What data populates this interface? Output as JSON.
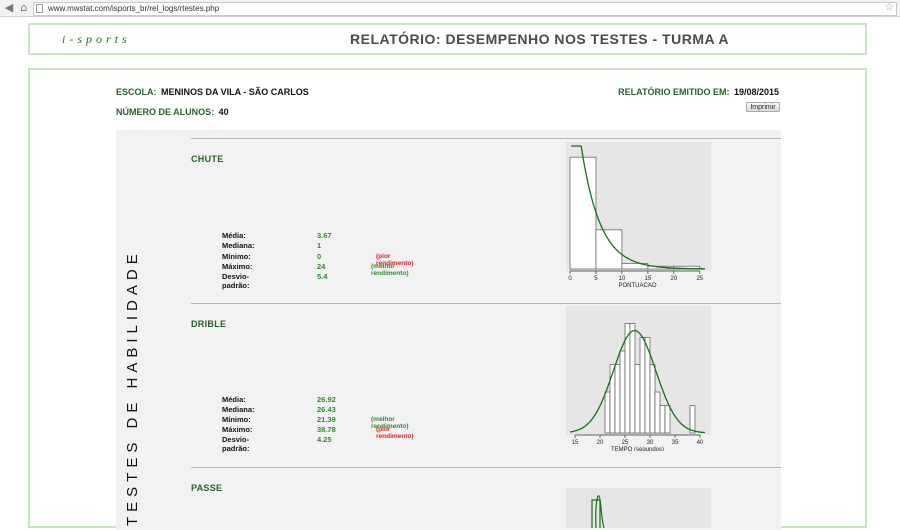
{
  "browser": {
    "url": "www.mwstat.com/isports_br/rel_logs/rtestes.php"
  },
  "header": {
    "logo": "i-sports",
    "title": "RELATÓRIO: DESEMPENHO NOS TESTES - TURMA A"
  },
  "info": {
    "school_label": "ESCOLA:",
    "school_value": "MENINOS DA VILA - SÃO CARLOS",
    "report_label": "RELATÓRIO EMITIDO EM:",
    "report_value": "19/08/2015",
    "students_label": "NÚMERO DE ALUNOS:",
    "students_value": "40",
    "print_label": "Imprimir"
  },
  "vertical_label": "TESTES DE HABILIDADE",
  "sections": [
    {
      "title": "CHUTE",
      "stats": [
        {
          "label": "Média:",
          "value": "3.67",
          "note": ""
        },
        {
          "label": "Mediana:",
          "value": "1",
          "note": ""
        },
        {
          "label": "Mínimo:",
          "value": "0",
          "note": "(pior rendimento)",
          "note_color": "red"
        },
        {
          "label": "Máximo:",
          "value": "24",
          "note": "(melhor rendimento)",
          "note_color": "green"
        },
        {
          "label": "Desvio-padrão:",
          "value": "5.4",
          "note": ""
        }
      ]
    },
    {
      "title": "DRIBLE",
      "stats": [
        {
          "label": "Média:",
          "value": "26.92",
          "note": ""
        },
        {
          "label": "Mediana:",
          "value": "26.43",
          "note": ""
        },
        {
          "label": "Mínimo:",
          "value": "21.39",
          "note": "(melhor rendimento)",
          "note_color": "green"
        },
        {
          "label": "Máximo:",
          "value": "38.78",
          "note": "(pior rendimento)",
          "note_color": "red"
        },
        {
          "label": "Desvio-padrão:",
          "value": "4.25",
          "note": ""
        }
      ]
    },
    {
      "title": "PASSE",
      "stats": []
    }
  ],
  "chart_data": [
    {
      "type": "bar",
      "xlabel": "PONTUACAO",
      "xlim": [
        0,
        26
      ],
      "ylim": [
        0,
        22
      ],
      "x_ticks": [
        0,
        5,
        10,
        15,
        20,
        25
      ],
      "bins": [
        {
          "x0": 0,
          "x1": 5,
          "count": 20
        },
        {
          "x0": 5,
          "x1": 10,
          "count": 7
        },
        {
          "x0": 10,
          "x1": 15,
          "count": 1
        },
        {
          "x0": 15,
          "x1": 20,
          "count": 0.5
        },
        {
          "x0": 20,
          "x1": 25,
          "count": 0.5
        }
      ],
      "curve": {
        "kind": "exponential",
        "mean": 3.67
      },
      "colors": {
        "bars": "#555555",
        "curve": "#1a6e1a"
      }
    },
    {
      "type": "bar",
      "xlabel": "TEMPO (segundos)",
      "xlim": [
        14,
        41
      ],
      "ylim": [
        0,
        9
      ],
      "x_ticks": [
        15,
        20,
        25,
        30,
        35,
        40
      ],
      "bins": [
        {
          "x0": 21,
          "x1": 22,
          "count": 3
        },
        {
          "x0": 22,
          "x1": 23,
          "count": 5
        },
        {
          "x0": 23,
          "x1": 24,
          "count": 5
        },
        {
          "x0": 24,
          "x1": 25,
          "count": 6
        },
        {
          "x0": 25,
          "x1": 26,
          "count": 8
        },
        {
          "x0": 26,
          "x1": 27,
          "count": 8
        },
        {
          "x0": 27,
          "x1": 28,
          "count": 5
        },
        {
          "x0": 28,
          "x1": 29,
          "count": 7
        },
        {
          "x0": 29,
          "x1": 30,
          "count": 7
        },
        {
          "x0": 30,
          "x1": 31,
          "count": 5
        },
        {
          "x0": 31,
          "x1": 32,
          "count": 3
        },
        {
          "x0": 32,
          "x1": 33,
          "count": 2
        },
        {
          "x0": 33,
          "x1": 34,
          "count": 2
        },
        {
          "x0": 38,
          "x1": 39,
          "count": 2
        }
      ],
      "curve": {
        "kind": "normal",
        "mean": 26.92,
        "sd": 4.25,
        "peak": 7.5
      },
      "colors": {
        "bars": "#555555",
        "curve": "#1a6e1a"
      }
    }
  ]
}
